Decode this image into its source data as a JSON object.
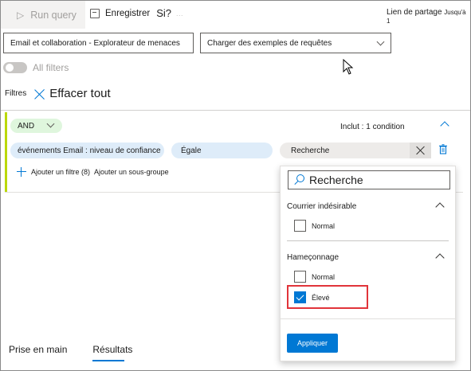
{
  "toolbar": {
    "run_query": "Run query",
    "save": "Enregistrer",
    "save_separator": "Si?",
    "save_faded": "...",
    "share_link": "Lien de partage",
    "share_until": "Jusqu'à 1"
  },
  "selectors": {
    "explorer": "Email et collaboration - Explorateur de menaces",
    "samples": "Charger des exemples de requêtes"
  },
  "all_filters_label": "All filters",
  "filters": {
    "label": "Filtres",
    "clear_all": "Effacer tout"
  },
  "group": {
    "operator": "AND",
    "include_text": "Inclut : 1 condition",
    "condition": {
      "field": "événements Email : niveau de confiance",
      "operator": "Égale",
      "value_placeholder": "Recherche"
    },
    "add_filter": "Ajouter un filtre (8)",
    "add_subgroup": "Ajouter un sous-groupe"
  },
  "dropdown": {
    "search_placeholder": "Recherche",
    "sections": [
      {
        "title": "Courrier indésirable",
        "options": [
          {
            "label": "Normal",
            "checked": false
          }
        ]
      },
      {
        "title": "Hameçonnage",
        "options": [
          {
            "label": "Normal",
            "checked": false
          },
          {
            "label": "Élevé",
            "checked": true
          }
        ]
      }
    ],
    "apply": "Appliquer"
  },
  "tabs": [
    {
      "label": "Prise en main",
      "active": false
    },
    {
      "label": "Résultats",
      "active": true
    }
  ],
  "colors": {
    "accent": "#0078d4",
    "highlight": "#e1343a",
    "group_border": "#bad80a",
    "and_pill": "#dff6dd",
    "condition_pill": "#deecf9"
  }
}
